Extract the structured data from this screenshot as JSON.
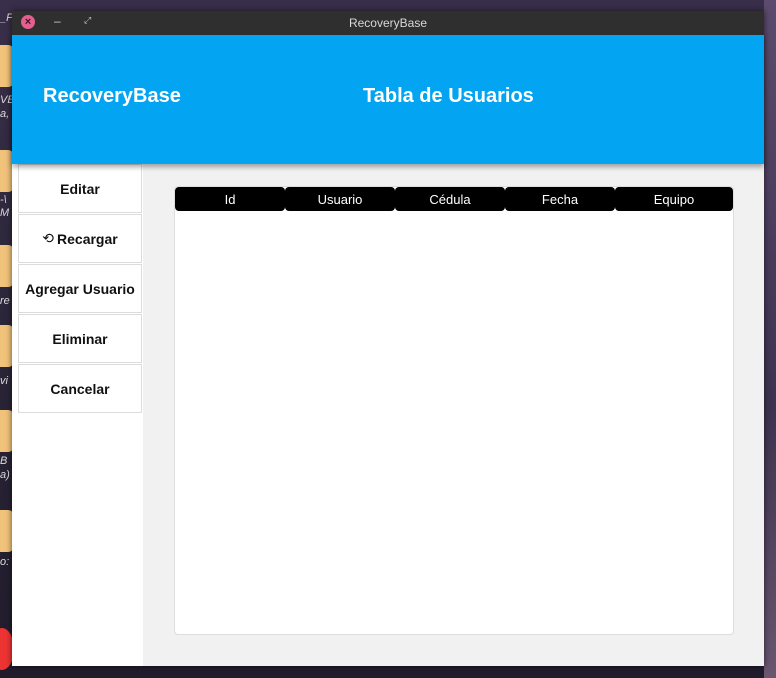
{
  "window": {
    "title": "RecoveryBase"
  },
  "appbar": {
    "brand": "RecoveryBase",
    "screen_title": "Tabla de Usuarios"
  },
  "sidebar": {
    "items": [
      {
        "label": "Editar"
      },
      {
        "label": "Recargar",
        "icon": "refresh-icon"
      },
      {
        "label": "Agregar Usuario"
      },
      {
        "label": "Eliminar"
      },
      {
        "label": "Cancelar"
      }
    ]
  },
  "table": {
    "columns": [
      "Id",
      "Usuario",
      "Cédula",
      "Fecha",
      "Equipo"
    ],
    "rows": []
  },
  "desktop": {
    "labels": [
      "_F",
      "VE",
      "a,",
      "-\\",
      "M",
      "re",
      "vi",
      "B",
      "a)",
      "o:"
    ]
  },
  "colors": {
    "accent": "#03a5f2",
    "header": "#000000",
    "close": "#e45f8e"
  }
}
